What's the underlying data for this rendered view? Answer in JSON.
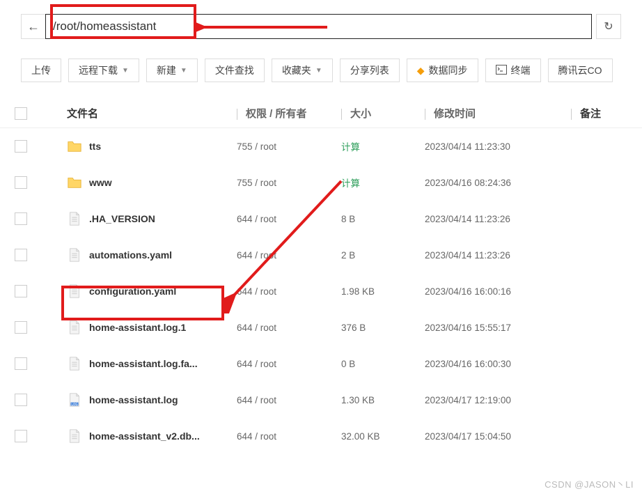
{
  "path": "/root/homeassistant",
  "back_icon": "←",
  "refresh_icon": "↻",
  "toolbar": {
    "upload": "上传",
    "remote_download": "远程下载",
    "new": "新建",
    "file_search": "文件查找",
    "favorites": "收藏夹",
    "share_list": "分享列表",
    "data_sync": "数据同步",
    "terminal": "终端",
    "tencent_cloud": "腾讯云CO"
  },
  "headers": {
    "name": "文件名",
    "perm": "权限 / 所有者",
    "size": "大小",
    "mtime": "修改时间",
    "note": "备注"
  },
  "rows": [
    {
      "type": "folder",
      "name": "tts",
      "perm": "755 / root",
      "size": "计算",
      "size_calc": true,
      "mtime": "2023/04/14 11:23:30"
    },
    {
      "type": "folder",
      "name": "www",
      "perm": "755 / root",
      "size": "计算",
      "size_calc": true,
      "mtime": "2023/04/16 08:24:36"
    },
    {
      "type": "file",
      "name": ".HA_VERSION",
      "perm": "644 / root",
      "size": "8 B",
      "mtime": "2023/04/14 11:23:26"
    },
    {
      "type": "file",
      "name": "automations.yaml",
      "perm": "644 / root",
      "size": "2 B",
      "mtime": "2023/04/14 11:23:26"
    },
    {
      "type": "file",
      "name": "configuration.yaml",
      "perm": "644 / root",
      "size": "1.98 KB",
      "mtime": "2023/04/16 16:00:16"
    },
    {
      "type": "file",
      "name": "home-assistant.log.1",
      "perm": "644 / root",
      "size": "376 B",
      "mtime": "2023/04/16 15:55:17"
    },
    {
      "type": "file",
      "name": "home-assistant.log.fa...",
      "perm": "644 / root",
      "size": "0 B",
      "mtime": "2023/04/16 16:00:30"
    },
    {
      "type": "log",
      "name": "home-assistant.log",
      "perm": "644 / root",
      "size": "1.30 KB",
      "mtime": "2023/04/17 12:19:00"
    },
    {
      "type": "file",
      "name": "home-assistant_v2.db...",
      "perm": "644 / root",
      "size": "32.00 KB",
      "mtime": "2023/04/17 15:04:50"
    }
  ],
  "watermark": "CSDN @JASON丶LI"
}
